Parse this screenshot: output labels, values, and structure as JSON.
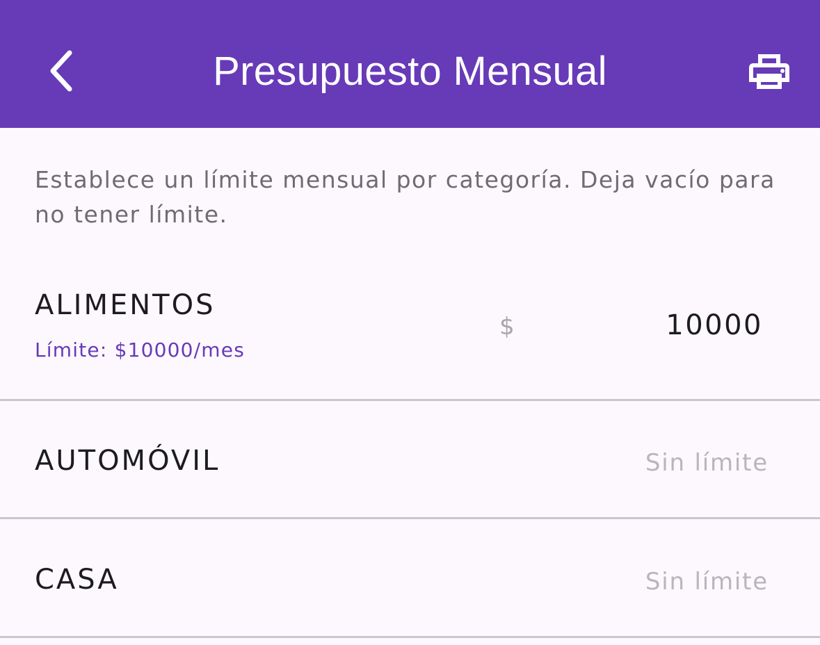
{
  "header": {
    "title": "Presupuesto Mensual",
    "back_icon": "chevron-left-icon",
    "print_icon": "printer-icon"
  },
  "intro": "Establece un límite mensual por categoría. Deja vacío para no tener límite.",
  "categories": [
    {
      "name": "ALIMENTOS",
      "subtitle": "Límite: $10000/mes",
      "currency": "$",
      "value": "10000"
    },
    {
      "name": "AUTOMÓVIL",
      "placeholder": "Sin límite"
    },
    {
      "name": "CASA",
      "placeholder": "Sin límite"
    }
  ],
  "colors": {
    "primary": "#673ab7",
    "background": "#fcf8fd",
    "divider": "#cac5cf"
  }
}
